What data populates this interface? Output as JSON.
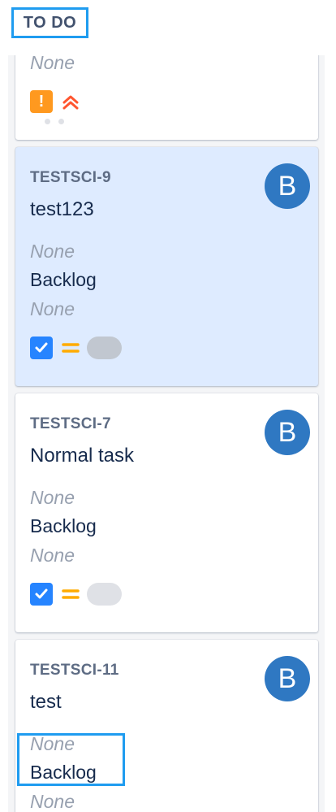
{
  "column": {
    "title": "TO DO"
  },
  "cards": [
    {
      "key": "",
      "summary": "",
      "fields": {
        "epic": "None",
        "status": "",
        "sprint": ""
      },
      "type_icon": "warning-icon",
      "priority": "highest",
      "color_type": "#ff991f",
      "color_priority": "#ff5630"
    },
    {
      "key": "TESTSCI-9",
      "summary": "test123",
      "fields": {
        "epic": "None",
        "status": "Backlog",
        "sprint": "None"
      },
      "avatar": "B",
      "type_icon": "checkbox-icon",
      "priority": "medium",
      "selected": true
    },
    {
      "key": "TESTSCI-7",
      "summary": "Normal task",
      "fields": {
        "epic": "None",
        "status": "Backlog",
        "sprint": "None"
      },
      "avatar": "B",
      "type_icon": "checkbox-icon",
      "priority": "medium"
    },
    {
      "key": "TESTSCI-11",
      "summary": "test",
      "fields": {
        "epic": "None",
        "status": "Backlog",
        "sprint": "None"
      },
      "avatar": "B"
    }
  ],
  "colors": {
    "accent_highlight": "#1f9cf0",
    "selected_bg": "#deebff",
    "avatar_bg": "#2f78c2",
    "task_blue": "#2684ff",
    "priority_medium": "#ffab00"
  }
}
